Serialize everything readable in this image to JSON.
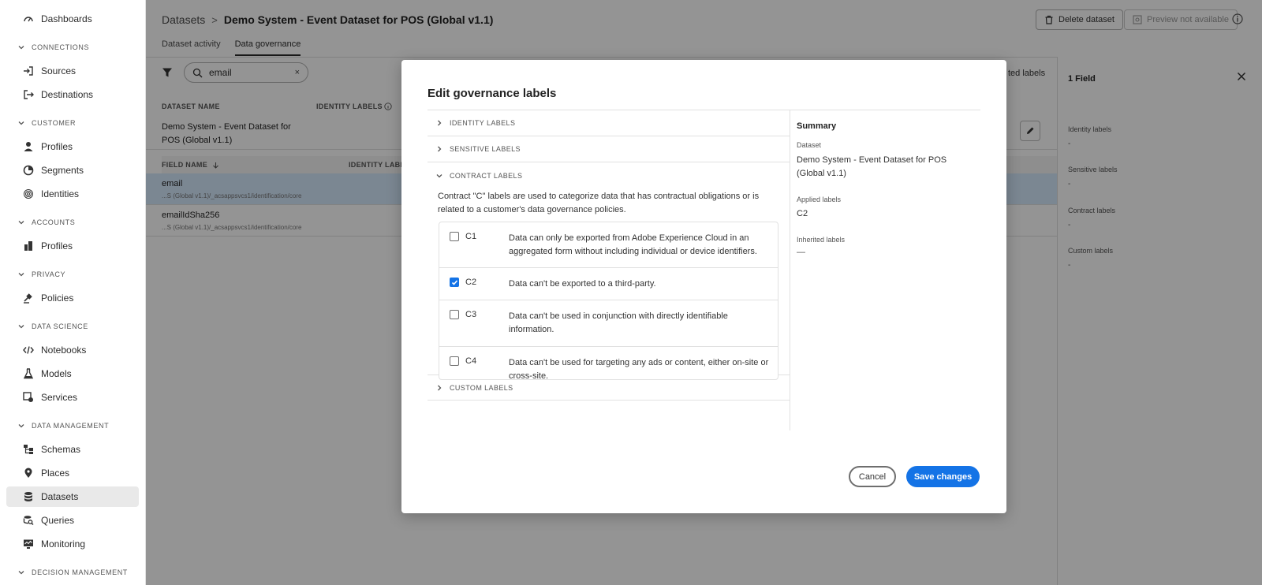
{
  "sidebar": {
    "top_item": "Dashboards",
    "sections": [
      {
        "title": "CONNECTIONS",
        "items": [
          "Sources",
          "Destinations"
        ]
      },
      {
        "title": "CUSTOMER",
        "items": [
          "Profiles",
          "Segments",
          "Identities"
        ]
      },
      {
        "title": "ACCOUNTS",
        "items": [
          "Profiles"
        ]
      },
      {
        "title": "PRIVACY",
        "items": [
          "Policies"
        ]
      },
      {
        "title": "DATA SCIENCE",
        "items": [
          "Notebooks",
          "Models",
          "Services"
        ]
      },
      {
        "title": "DATA MANAGEMENT",
        "items": [
          "Schemas",
          "Places",
          "Datasets",
          "Queries",
          "Monitoring"
        ]
      },
      {
        "title": "DECISION MANAGEMENT",
        "items": []
      }
    ],
    "active_item": "Datasets"
  },
  "header": {
    "breadcrumb_root": "Datasets",
    "breadcrumb_separator": ">",
    "breadcrumb_current": "Demo System - Event Dataset for POS (Global v1.1)",
    "delete_label": "Delete dataset",
    "preview_label": "Preview not available"
  },
  "tabs": [
    "Dataset activity",
    "Data governance"
  ],
  "selected_tab": "Data governance",
  "search": {
    "value": "email",
    "clear": "×"
  },
  "table": {
    "col_dataset_name": "DATASET NAME",
    "col_identity_labels": "IDENTITY LABELS",
    "col_field_name": "FIELD NAME",
    "col_field_identity_labels": "IDENTITY LABELS",
    "applied_labels_partial": "ted labels",
    "dataset_row": "Demo System - Event Dataset for POS (Global v1.1)",
    "fields": [
      {
        "name": "email",
        "path": "...S (Global v1.1)/_acsappsvcs1/identification/core"
      },
      {
        "name": "emailIdSha256",
        "path": "...S (Global v1.1)/_acsappsvcs1/identification/core"
      }
    ]
  },
  "right_panel": {
    "title": "1 Field",
    "sections": [
      {
        "label": "Identity labels",
        "value": "-"
      },
      {
        "label": "Sensitive labels",
        "value": "-"
      },
      {
        "label": "Contract labels",
        "value": "-"
      },
      {
        "label": "Custom labels",
        "value": "-"
      }
    ]
  },
  "modal": {
    "title": "Edit governance labels",
    "accordions": {
      "identity": "IDENTITY LABELS",
      "sensitive": "SENSITIVE LABELS",
      "contract": "CONTRACT LABELS",
      "custom": "CUSTOM LABELS"
    },
    "contract_description": "Contract \"C\" labels are used to categorize data that has contractual obligations or is related to a customer's data governance policies.",
    "contract_labels": [
      {
        "code": "C1",
        "checked": false,
        "description": "Data can only be exported from Adobe Experience Cloud in an aggregated form without including individual or device identifiers."
      },
      {
        "code": "C2",
        "checked": true,
        "description": "Data can't be exported to a third-party."
      },
      {
        "code": "C3",
        "checked": false,
        "description": "Data can't be used in conjunction with directly identifiable information."
      },
      {
        "code": "C4",
        "checked": false,
        "description": "Data can't be used for targeting any ads or content, either on-site or cross-site."
      }
    ],
    "summary": {
      "title": "Summary",
      "dataset_label": "Dataset",
      "dataset_value": "Demo System - Event Dataset for POS (Global v1.1)",
      "applied_label": "Applied labels",
      "applied_value": "C2",
      "inherited_label": "Inherited labels",
      "inherited_value": "—"
    },
    "cancel_label": "Cancel",
    "save_label": "Save changes"
  },
  "colors": {
    "accent": "#1473e6",
    "selected_row": "#d5e8fc",
    "overlay": "rgba(0,0,0,0.42)"
  }
}
